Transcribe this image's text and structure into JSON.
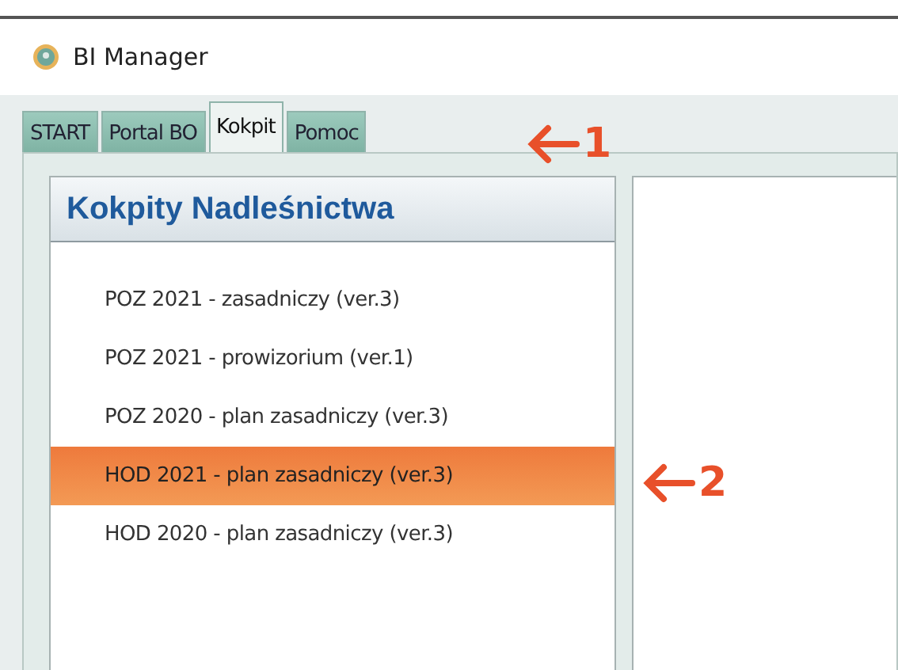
{
  "window": {
    "title": "BI Manager"
  },
  "tabs": [
    {
      "label": "START",
      "selected": false
    },
    {
      "label": "Portal BO",
      "selected": false
    },
    {
      "label": "Kokpit",
      "selected": true
    },
    {
      "label": "Pomoc",
      "selected": false
    }
  ],
  "panel": {
    "title": "Kokpity Nadleśnictwa",
    "items": [
      {
        "label": "POZ 2021 - zasadniczy (ver.3)",
        "selected": false
      },
      {
        "label": "POZ 2021 - prowizorium (ver.1)",
        "selected": false
      },
      {
        "label": "POZ 2020 - plan zasadniczy (ver.3)",
        "selected": false
      },
      {
        "label": "HOD 2021 - plan zasadniczy (ver.3)",
        "selected": true
      },
      {
        "label": "HOD 2020 - plan zasadniczy (ver.3)",
        "selected": false
      }
    ]
  },
  "callouts": [
    {
      "label": "1"
    },
    {
      "label": "2"
    }
  ]
}
